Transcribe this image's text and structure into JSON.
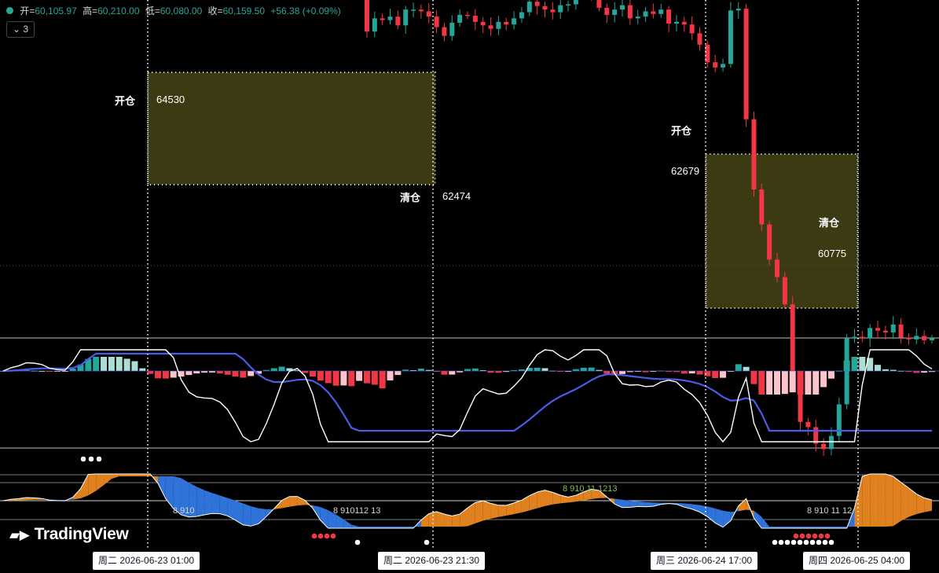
{
  "header": {
    "open_label": "开=",
    "open_value": "60,105.97",
    "high_label": "高=",
    "high_value": "60,210.00",
    "low_label": "低=",
    "low_value": "60,080.00",
    "close_label": "收=",
    "close_value": "60,159.50",
    "change": "+56.38 (+0.09%)"
  },
  "collapse_button": {
    "label": "3"
  },
  "logo": {
    "text": "TradingView"
  },
  "colors": {
    "up": "#26a69a",
    "down": "#f23645",
    "box_fill": "#3b3a12",
    "macd_signal": "#4a5ce8",
    "macd_line": "#ffffff",
    "hist_up_strong": "#26a69a",
    "hist_up_weak": "#acdfd3",
    "hist_down_strong": "#f23645",
    "hist_down_weak": "#fbc4ca",
    "osc_orange": "#e0811f",
    "osc_blue": "#2f72d8"
  },
  "time_labels": [
    "周二 2026-06-23   01:00",
    "周二 2026-06-23   21:30",
    "周三 2026-06-24   17:00",
    "周四 2026-06-25   04:00"
  ],
  "chart_data": [
    {
      "type": "candlestick",
      "title": "",
      "last_bar": {
        "open": 60105.97,
        "high": 60210.0,
        "low": 60080.0,
        "close": 60159.5,
        "change": 56.38,
        "change_pct": 0.09
      },
      "closes": [
        64150,
        64220,
        64190,
        64210,
        64170,
        64180,
        64160,
        64190,
        64200,
        64480,
        64850,
        65060,
        65450,
        65750,
        65720,
        66220,
        66190,
        66010,
        65900,
        65780,
        65620,
        65550,
        65500,
        65400,
        65440,
        65460,
        65300,
        65350,
        65280,
        65000,
        64980,
        64930,
        64950,
        64960,
        65150,
        65170,
        65180,
        65130,
        65090,
        64980,
        64570,
        64380,
        64400,
        63620,
        63700,
        63710,
        63480,
        62650,
        62800,
        62780,
        62820,
        62720,
        62900,
        62900,
        62880,
        62820,
        62700,
        62600,
        62750,
        62840,
        62830,
        62760,
        62720,
        62680,
        62760,
        62730,
        62800,
        62870,
        62990,
        62940,
        62900,
        62870,
        62950,
        62960,
        63080,
        63180,
        63050,
        62920,
        62840,
        62900,
        62950,
        62800,
        62820,
        62880,
        62850,
        62900,
        62740,
        62760,
        62730,
        62630,
        62500,
        62300,
        62240,
        62280,
        62890,
        62910,
        61650,
        60850,
        60450,
        60050,
        59850,
        59540,
        58700,
        58200,
        58140,
        57950,
        57890,
        58040,
        58400,
        59150,
        59170,
        59150,
        59270,
        59240,
        59220,
        59310,
        59160,
        59140,
        59180,
        59130,
        59150
      ],
      "markers": [
        {
          "text": "开仓"
        },
        {
          "text": "64530"
        },
        {
          "text": "清仓"
        },
        {
          "text": "62474"
        },
        {
          "text": "开仓"
        },
        {
          "text": "62679"
        },
        {
          "text": "清仓"
        },
        {
          "text": "60775"
        }
      ],
      "trade_boxes": [
        {
          "entry": 64530,
          "exit": 62474
        },
        {
          "entry": 62679,
          "exit": 60775
        }
      ]
    },
    {
      "type": "bar",
      "title": "",
      "series": [
        {
          "values": []
        }
      ]
    },
    {
      "type": "area",
      "title": "",
      "annotations": [
        {
          "text": "8 910"
        },
        {
          "text": "8 910112 13"
        },
        {
          "text": "8 910 11 1213"
        },
        {
          "text": "8 910 11 12"
        }
      ]
    }
  ]
}
